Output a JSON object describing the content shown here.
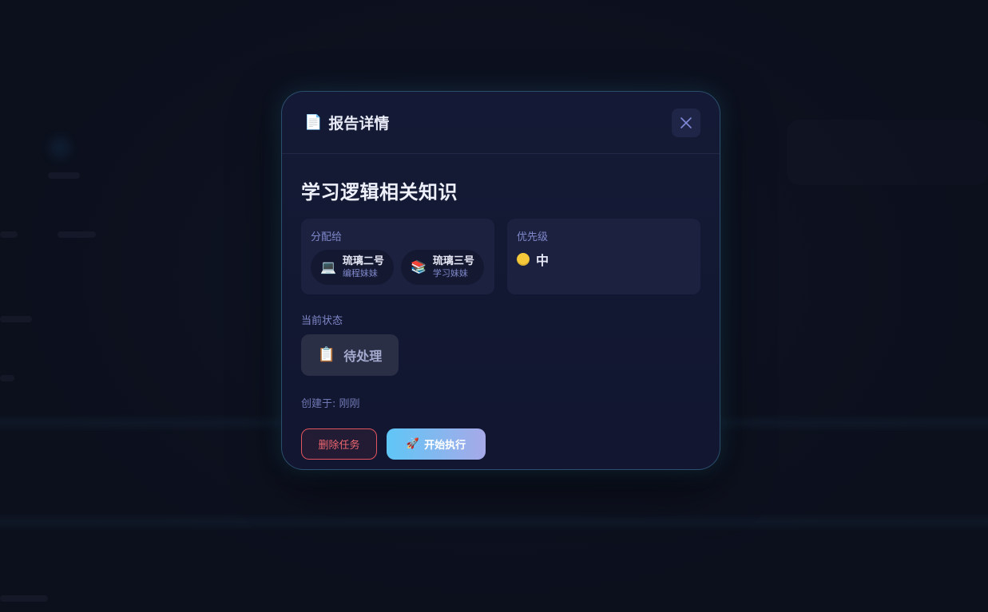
{
  "modal": {
    "title": "报告详情",
    "title_icon": "document-icon",
    "close_icon": "close-icon",
    "task_title": "学习逻辑相关知识",
    "assigned_label": "分配给",
    "assignees": [
      {
        "emoji": "💻",
        "name": "琉璃二号",
        "role": "编程妹妹"
      },
      {
        "emoji": "📚",
        "name": "琉璃三号",
        "role": "学习妹妹"
      }
    ],
    "priority_label": "优先级",
    "priority_value": "中",
    "priority_color": "#f5c93a",
    "status_label": "当前状态",
    "status_emoji": "📋",
    "status_value": "待处理",
    "created": "创建于: 刚刚",
    "delete_label": "删除任务",
    "run_emoji": "🚀",
    "run_label": "开始执行"
  },
  "colors": {
    "accent_gradient_start": "#5fc6f6",
    "accent_gradient_end": "#a7a9e8",
    "danger": "#e2545e",
    "modal_bg": "#131833",
    "label": "#7f88c9"
  }
}
